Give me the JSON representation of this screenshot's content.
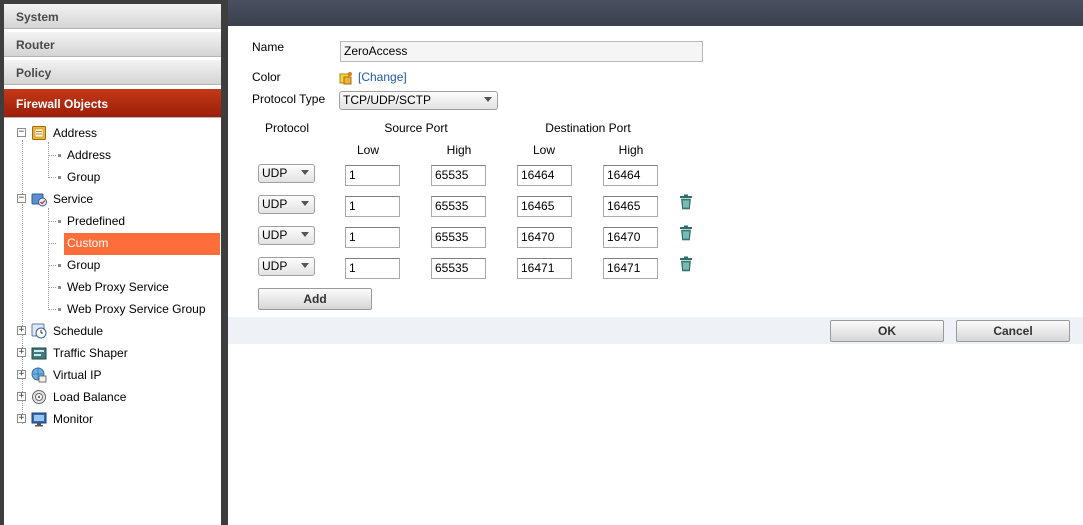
{
  "nav": {
    "categories": [
      {
        "label": "System"
      },
      {
        "label": "Router"
      },
      {
        "label": "Policy"
      },
      {
        "label": "Firewall Objects"
      }
    ],
    "tree": {
      "address": {
        "label": "Address",
        "expander": "−",
        "children": [
          "Address",
          "Group"
        ]
      },
      "service": {
        "label": "Service",
        "expander": "−",
        "children": [
          "Predefined",
          "Custom",
          "Group",
          "Web Proxy Service",
          "Web Proxy Service Group"
        ]
      },
      "others": [
        {
          "label": "Schedule",
          "expander": "+"
        },
        {
          "label": "Traffic Shaper",
          "expander": "+"
        },
        {
          "label": "Virtual IP",
          "expander": "+"
        },
        {
          "label": "Load Balance",
          "expander": "+"
        },
        {
          "label": "Monitor",
          "expander": "+"
        }
      ]
    }
  },
  "form": {
    "name_label": "Name",
    "name_value": "ZeroAccess",
    "color_label": "Color",
    "color_change": "[Change]",
    "protocol_type_label": "Protocol Type",
    "protocol_type_value": "TCP/UDP/SCTP",
    "headers": {
      "protocol": "Protocol",
      "source_port": "Source Port",
      "destination_port": "Destination Port",
      "low": "Low",
      "high": "High"
    },
    "rows": [
      {
        "protocol": "UDP",
        "src_low": "1",
        "src_high": "65535",
        "dst_low": "16464",
        "dst_high": "16464",
        "deletable": false
      },
      {
        "protocol": "UDP",
        "src_low": "1",
        "src_high": "65535",
        "dst_low": "16465",
        "dst_high": "16465",
        "deletable": true
      },
      {
        "protocol": "UDP",
        "src_low": "1",
        "src_high": "65535",
        "dst_low": "16470",
        "dst_high": "16470",
        "deletable": true
      },
      {
        "protocol": "UDP",
        "src_low": "1",
        "src_high": "65535",
        "dst_low": "16471",
        "dst_high": "16471",
        "deletable": true
      }
    ],
    "add_label": "Add",
    "ok_label": "OK",
    "cancel_label": "Cancel"
  },
  "colors": {
    "active_category": "#b02c10",
    "selected_item": "#ff6d3a",
    "top_bar": "#444a57",
    "footer": "#eef1f6",
    "link": "#1f5aa6",
    "trash": "#2f6f6a"
  },
  "icons": {
    "address": "address-book-icon",
    "service": "service-icon",
    "schedule": "clock-icon",
    "traffic_shaper": "traffic-shaper-icon",
    "virtual_ip": "virtual-ip-icon",
    "load_balance": "load-balance-icon",
    "monitor": "monitor-icon",
    "color": "color-swatch-icon",
    "delete": "trash-icon"
  }
}
